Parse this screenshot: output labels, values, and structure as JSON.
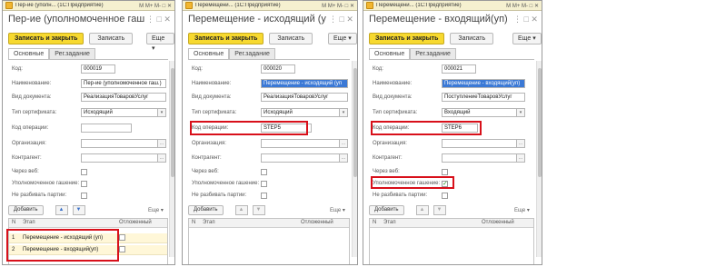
{
  "windows": [
    {
      "titlebar": "Пер-ие (уполн... (1С:Предприятие)",
      "title": "Пер-ие (уполномоченное гаш.) (АСП Видь",
      "toolbar": {
        "save_close": "Записать и закрыть",
        "save": "Записать",
        "more": "Еще ▾"
      },
      "tabs": [
        "Основные",
        "Рег.задание"
      ],
      "fields": {
        "code": {
          "label": "Код:",
          "value": "000019"
        },
        "name": {
          "label": "Наименование:",
          "value": "Пер-ие (уполномоченное гаш.)"
        },
        "doc_type": {
          "label": "Вид документа:",
          "value": "РеализацияТоваровУслуг"
        },
        "cert_type": {
          "label": "Тип сертификата:",
          "value": "Исходящий"
        },
        "op_code": {
          "label": "Код операции:",
          "value": ""
        },
        "org": {
          "label": "Организация:",
          "value": ""
        },
        "counterparty": {
          "label": "Контрагент:",
          "value": ""
        },
        "via_web": {
          "label": "Через веб:",
          "checked": false
        },
        "auth_cancel": {
          "label": "Уполномоченное гашение:",
          "checked": false
        },
        "no_split": {
          "label": "Не разбивать партии:",
          "checked": false
        }
      },
      "table": {
        "add": "Добавить",
        "more": "Еще ▾",
        "columns": [
          "N",
          "Этап",
          "Отложенный"
        ],
        "rows": [
          {
            "n": "1",
            "stage": "Перемещение - исходящий (уп)"
          },
          {
            "n": "2",
            "stage": "Перемещение - входящий(уп)"
          }
        ]
      }
    },
    {
      "titlebar": "Перемещени... (1С:Предприятие)",
      "title": "Перемещение - исходящий (уп) (АСП Види",
      "toolbar": {
        "save_close": "Записать и закрыть",
        "save": "Записать",
        "more": "Еще ▾"
      },
      "tabs": [
        "Основные",
        "Рег.задание"
      ],
      "fields": {
        "code": {
          "label": "Код:",
          "value": "000020"
        },
        "name": {
          "label": "Наименование:",
          "value": "Перемещение - исходящий (уп"
        },
        "doc_type": {
          "label": "Вид документа:",
          "value": "РеализацияТоваровУслуг"
        },
        "cert_type": {
          "label": "Тип сертификата:",
          "value": "Исходящий"
        },
        "op_code": {
          "label": "Код операции:",
          "value": "STEP5"
        },
        "org": {
          "label": "Организация:",
          "value": ""
        },
        "counterparty": {
          "label": "Контрагент:",
          "value": ""
        },
        "via_web": {
          "label": "Через веб:",
          "checked": false
        },
        "auth_cancel": {
          "label": "Уполномоченное гашение:",
          "checked": false
        },
        "no_split": {
          "label": "Не разбивать партии:",
          "checked": false
        }
      },
      "table": {
        "add": "Добавить",
        "more": "Еще ▾",
        "columns": [
          "N",
          "Этап",
          "Отложенный"
        ],
        "rows": []
      }
    },
    {
      "titlebar": "Перемещени... (1С:Предприятие)",
      "title": "Перемещение - входящий(уп) (АСП Виды",
      "toolbar": {
        "save_close": "Записать и закрыть",
        "save": "Записать",
        "more": "Еще ▾"
      },
      "tabs": [
        "Основные",
        "Рег.задание"
      ],
      "fields": {
        "code": {
          "label": "Код:",
          "value": "000021"
        },
        "name": {
          "label": "Наименование:",
          "value": "Перемещение - входящий(уп)"
        },
        "doc_type": {
          "label": "Вид документа:",
          "value": "ПоступлениеТоваровУслуг"
        },
        "cert_type": {
          "label": "Тип сертификата:",
          "value": "Входящий"
        },
        "op_code": {
          "label": "Код операции:",
          "value": "STEP6"
        },
        "org": {
          "label": "Организация:",
          "value": ""
        },
        "counterparty": {
          "label": "Контрагент:",
          "value": ""
        },
        "via_web": {
          "label": "Через веб:",
          "checked": false
        },
        "auth_cancel": {
          "label": "Уполномоченное гашение:",
          "checked": true
        },
        "no_split": {
          "label": "Не разбивать партии:",
          "checked": false
        }
      },
      "table": {
        "add": "Добавить",
        "more": "Еще ▾",
        "columns": [
          "N",
          "Этап",
          "Отложенный"
        ],
        "rows": []
      }
    }
  ],
  "titlebar_buttons": "M M+ M- □ ✕",
  "doc_controls": "⋮ □ ✕",
  "check_mark": "✓",
  "up_arrow": "▲",
  "down_arrow": "▼",
  "dropdown_glyph": "▾",
  "ellipsis_glyph": "...",
  "colors": {
    "accent_yellow": "#f7d92f",
    "highlight_red": "#d8101a",
    "selection_blue": "#3b79d6"
  }
}
